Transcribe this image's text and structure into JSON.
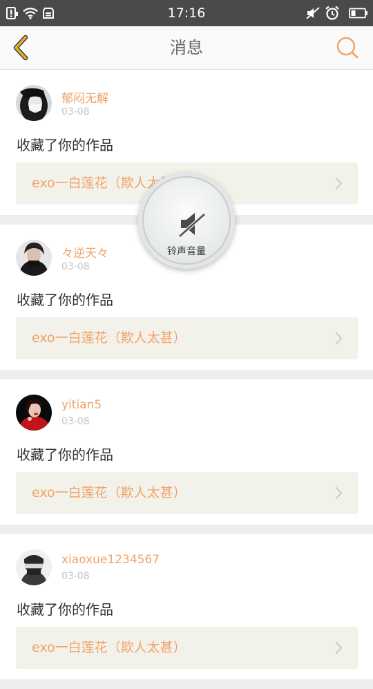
{
  "status_bar": {
    "time": "17:16",
    "icons": [
      "notification-alert-icon",
      "wifi-icon",
      "storage-icon",
      "mute-icon",
      "alarm-icon",
      "battery-icon"
    ]
  },
  "nav": {
    "title": "消息",
    "back_icon": "chevron-left-icon",
    "search_icon": "search-icon"
  },
  "messages": [
    {
      "username": "郁闷无解",
      "date": "03-08",
      "action": "收藏了你的作品",
      "work_title": "exo一白莲花（欺人太甚）"
    },
    {
      "username": "々逆天々",
      "date": "03-08",
      "action": "收藏了你的作品",
      "work_title": "exo一白莲花（欺人太甚）"
    },
    {
      "username": "yitian5",
      "date": "03-08",
      "action": "收藏了你的作品",
      "work_title": "exo一白莲花（欺人太甚）"
    },
    {
      "username": "xiaoxue1234567",
      "date": "03-08",
      "action": "收藏了你的作品",
      "work_title": "exo一白莲花（欺人太甚）"
    }
  ],
  "volume_toast": {
    "label": "铃声音量",
    "icon": "speaker-muted-icon"
  },
  "colors": {
    "accent": "#f0a36a",
    "back_arrow": "#e8b322",
    "status_bar": "#4a4a4a",
    "link_background": "#f3f2ea"
  }
}
